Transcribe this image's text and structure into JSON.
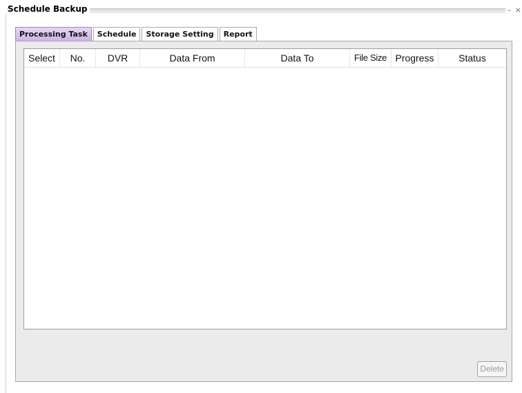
{
  "window": {
    "title": "Schedule Backup",
    "controls": {
      "minimize": "–",
      "close": "×"
    }
  },
  "tabs": [
    {
      "label": "Processing Task",
      "active": true
    },
    {
      "label": "Schedule",
      "active": false
    },
    {
      "label": "Storage Setting",
      "active": false
    },
    {
      "label": "Report",
      "active": false
    }
  ],
  "table": {
    "columns": [
      "Select",
      "No.",
      "DVR",
      "Data From",
      "Data To",
      "File Size",
      "Progress",
      "Status"
    ],
    "rows": []
  },
  "actions": {
    "delete_label": "Delete",
    "delete_enabled": false
  },
  "colors": {
    "active_tab": "#d8c4ec",
    "panel_background": "#ebebeb"
  }
}
